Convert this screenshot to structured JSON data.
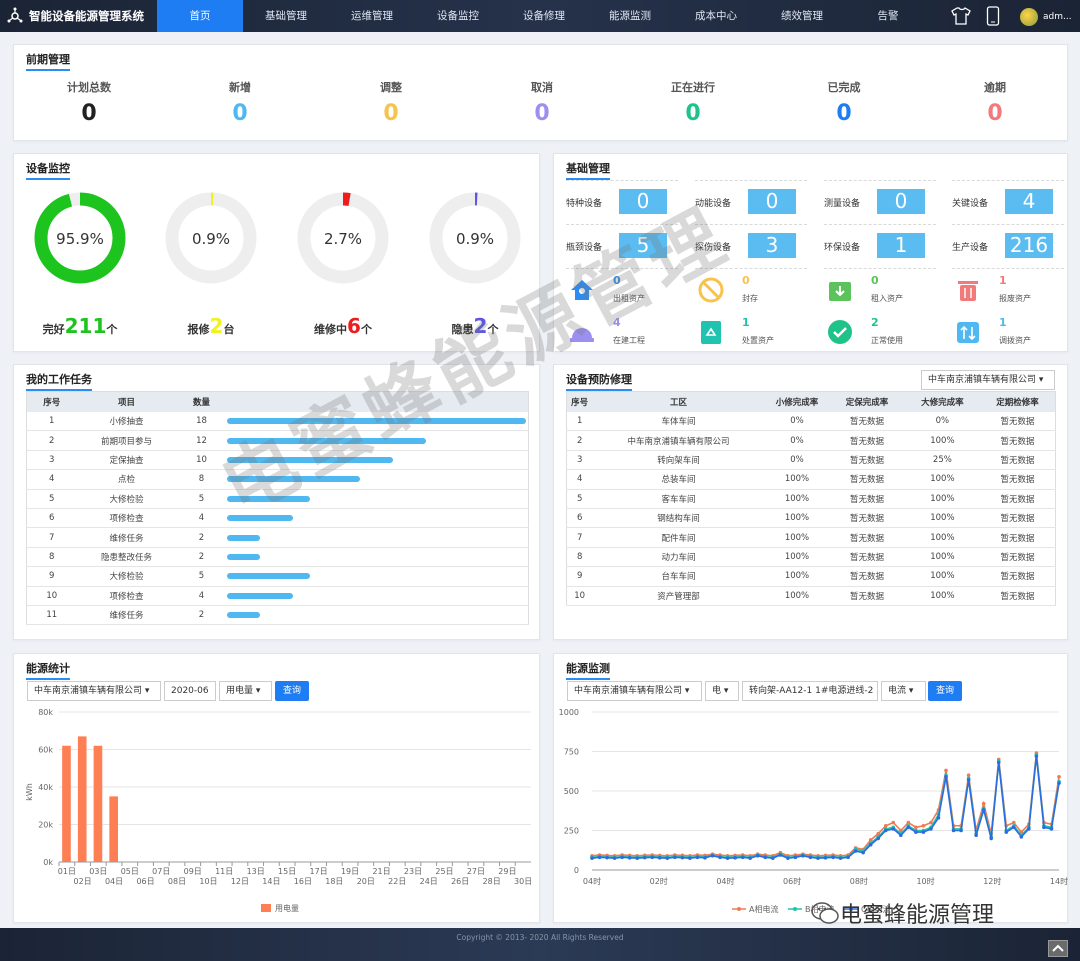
{
  "app": {
    "title": "智能设备能源管理系统",
    "user": "adm..."
  },
  "nav": [
    "首页",
    "基础管理",
    "运维管理",
    "设备监控",
    "设备修理",
    "能源监测",
    "成本中心",
    "绩效管理",
    "告警"
  ],
  "pre": {
    "title": "前期管理",
    "stats": [
      {
        "label": "计划总数",
        "value": "0",
        "color": "#222222"
      },
      {
        "label": "新增",
        "value": "0",
        "color": "#4fb8f0"
      },
      {
        "label": "调整",
        "value": "0",
        "color": "#f7c34d"
      },
      {
        "label": "取消",
        "value": "0",
        "color": "#9b8ff0"
      },
      {
        "label": "正在进行",
        "value": "0",
        "color": "#1fc38a"
      },
      {
        "label": "已完成",
        "value": "0",
        "color": "#1e7df2"
      },
      {
        "label": "逾期",
        "value": "0",
        "color": "#f27a7a"
      }
    ]
  },
  "monitor": {
    "title": "设备监控",
    "donuts": [
      {
        "pct": "95.9%",
        "frac": 0.959,
        "color": "#1ec41e",
        "label": "完好",
        "count": "211",
        "unit": "个",
        "ccolor": "#1ec41e"
      },
      {
        "pct": "0.9%",
        "frac": 0.009,
        "color": "#f2f21e",
        "label": "报修",
        "count": "2",
        "unit": "台",
        "ccolor": "#f2f21e"
      },
      {
        "pct": "2.7%",
        "frac": 0.027,
        "color": "#ee1c1c",
        "label": "维修中",
        "count": "6",
        "unit": "个",
        "ccolor": "#ee1c1c"
      },
      {
        "pct": "0.9%",
        "frac": 0.009,
        "color": "#5b55e8",
        "label": "隐患",
        "count": "2",
        "unit": "个",
        "ccolor": "#5b55e8"
      }
    ]
  },
  "basic": {
    "title": "基础管理",
    "grid": [
      {
        "label": "特种设备",
        "value": "0"
      },
      {
        "label": "动能设备",
        "value": "0"
      },
      {
        "label": "测量设备",
        "value": "0"
      },
      {
        "label": "关键设备",
        "value": "4"
      },
      {
        "label": "瓶颈设备",
        "value": "5"
      },
      {
        "label": "探伤设备",
        "value": "3"
      },
      {
        "label": "环保设备",
        "value": "1"
      },
      {
        "label": "生产设备",
        "value": "216"
      }
    ],
    "assets": [
      {
        "icon": "house-icon",
        "num": "0",
        "text": "出租资产",
        "color": "#2d8cf0"
      },
      {
        "icon": "ban-icon",
        "num": "0",
        "text": "封存",
        "color": "#f7c34d"
      },
      {
        "icon": "download-box-icon",
        "num": "0",
        "text": "租入资产",
        "color": "#5cc35c"
      },
      {
        "icon": "trash-icon",
        "num": "1",
        "text": "报废资产",
        "color": "#f27a7a"
      },
      {
        "icon": "helmet-icon",
        "num": "4",
        "text": "在建工程",
        "color": "#9b8ff0"
      },
      {
        "icon": "recycle-icon",
        "num": "1",
        "text": "处置资产",
        "color": "#1fc3b0"
      },
      {
        "icon": "check-circle-icon",
        "num": "2",
        "text": "正常使用",
        "color": "#1fc38a"
      },
      {
        "icon": "transfer-icon",
        "num": "1",
        "text": "调拨资产",
        "color": "#4fb8f0"
      }
    ]
  },
  "tasks": {
    "title": "我的工作任务",
    "headers": [
      "序号",
      "项目",
      "数量"
    ],
    "max": 18,
    "rows": [
      {
        "no": "1",
        "item": "小修抽查",
        "qty": "18",
        "v": 18
      },
      {
        "no": "2",
        "item": "前期项目参与",
        "qty": "12",
        "v": 12
      },
      {
        "no": "3",
        "item": "定保抽查",
        "qty": "10",
        "v": 10
      },
      {
        "no": "4",
        "item": "点检",
        "qty": "8",
        "v": 8
      },
      {
        "no": "5",
        "item": "大修检验",
        "qty": "5",
        "v": 5
      },
      {
        "no": "6",
        "item": "项修检查",
        "qty": "4",
        "v": 4
      },
      {
        "no": "7",
        "item": "维修任务",
        "qty": "2",
        "v": 2
      },
      {
        "no": "8",
        "item": "隐患整改任务",
        "qty": "2",
        "v": 2
      },
      {
        "no": "9",
        "item": "大修检验",
        "qty": "5",
        "v": 5
      },
      {
        "no": "10",
        "item": "项修检查",
        "qty": "4",
        "v": 4
      },
      {
        "no": "11",
        "item": "维修任务",
        "qty": "2",
        "v": 2
      }
    ]
  },
  "prevent": {
    "title": "设备预防修理",
    "company": "中车南京浦镇车辆有限公司",
    "headers": [
      "序号",
      "工区",
      "小修完成率",
      "定保完成率",
      "大修完成率",
      "定期检修率"
    ],
    "rows": [
      [
        "1",
        "车体车间",
        "0%",
        "暂无数据",
        "0%",
        "暂无数据"
      ],
      [
        "2",
        "中车南京浦镇车辆有限公司",
        "0%",
        "暂无数据",
        "100%",
        "暂无数据"
      ],
      [
        "3",
        "转向架车间",
        "0%",
        "暂无数据",
        "25%",
        "暂无数据"
      ],
      [
        "4",
        "总装车间",
        "100%",
        "暂无数据",
        "100%",
        "暂无数据"
      ],
      [
        "5",
        "客车车间",
        "100%",
        "暂无数据",
        "100%",
        "暂无数据"
      ],
      [
        "6",
        "钢结构车间",
        "100%",
        "暂无数据",
        "100%",
        "暂无数据"
      ],
      [
        "7",
        "配件车间",
        "100%",
        "暂无数据",
        "100%",
        "暂无数据"
      ],
      [
        "8",
        "动力车间",
        "100%",
        "暂无数据",
        "100%",
        "暂无数据"
      ],
      [
        "9",
        "台车车间",
        "100%",
        "暂无数据",
        "100%",
        "暂无数据"
      ],
      [
        "10",
        "资产管理部",
        "100%",
        "暂无数据",
        "100%",
        "暂无数据"
      ]
    ]
  },
  "energy": {
    "title": "能源统计",
    "company": "中车南京浦镇车辆有限公司",
    "month": "2020-06",
    "type": "用电量",
    "query": "查询"
  },
  "emon": {
    "title": "能源监测",
    "company": "中车南京浦镇车辆有限公司",
    "medium": "电",
    "line": "转向架-AA12-1 1#电源进线-2",
    "param": "电流",
    "query": "查询"
  },
  "footer": {
    "copyright": "Copyright © 2013- 2020 All Rights Reserved"
  },
  "watermark": {
    "text": "电蜜蜂能源管理",
    "brand": "电蜜蜂能源管理"
  },
  "chart_data": [
    {
      "type": "bar",
      "title": "",
      "ylabel": "kWh",
      "ylim": [
        0,
        80000
      ],
      "yticks": [
        "0k",
        "20k",
        "40k",
        "60k",
        "80k"
      ],
      "categories": [
        "01日",
        "02日",
        "03日",
        "04日",
        "05日",
        "06日",
        "07日",
        "08日",
        "09日",
        "10日",
        "11日",
        "12日",
        "13日",
        "14日",
        "15日",
        "16日",
        "17日",
        "18日",
        "19日",
        "20日",
        "21日",
        "22日",
        "23日",
        "24日",
        "25日",
        "26日",
        "27日",
        "28日",
        "29日",
        "30日"
      ],
      "series": [
        {
          "name": "用电量",
          "color": "#ff7f55",
          "values": [
            62000,
            67000,
            62000,
            35000,
            0,
            0,
            0,
            0,
            0,
            0,
            0,
            0,
            0,
            0,
            0,
            0,
            0,
            0,
            0,
            0,
            0,
            0,
            0,
            0,
            0,
            0,
            0,
            0,
            0,
            0
          ]
        }
      ]
    },
    {
      "type": "line",
      "title": "",
      "ylim": [
        0,
        1000
      ],
      "yticks": [
        "0",
        "250",
        "500",
        "750",
        "1000"
      ],
      "xticks": [
        "04时",
        "02时",
        "04时",
        "06时",
        "08时",
        "10时",
        "12时",
        "14时"
      ],
      "series": [
        {
          "name": "A相电流",
          "color": "#f07a52",
          "values": [
            90,
            95,
            92,
            90,
            95,
            92,
            90,
            93,
            95,
            92,
            90,
            95,
            93,
            90,
            95,
            92,
            100,
            95,
            90,
            92,
            95,
            90,
            100,
            95,
            90,
            110,
            90,
            95,
            100,
            95,
            90,
            92,
            95,
            90,
            95,
            140,
            130,
            190,
            230,
            280,
            300,
            250,
            300,
            270,
            280,
            300,
            380,
            630,
            280,
            280,
            600,
            250,
            420,
            230,
            700,
            280,
            300,
            240,
            290,
            740,
            300,
            290,
            590
          ]
        },
        {
          "name": "B相电流",
          "color": "#1fc3b0",
          "values": [
            80,
            85,
            82,
            80,
            85,
            82,
            80,
            83,
            85,
            82,
            80,
            85,
            83,
            80,
            85,
            82,
            95,
            85,
            80,
            82,
            85,
            80,
            95,
            85,
            80,
            100,
            80,
            85,
            95,
            85,
            80,
            82,
            85,
            80,
            85,
            130,
            120,
            170,
            210,
            260,
            270,
            230,
            280,
            250,
            250,
            270,
            350,
            600,
            260,
            260,
            580,
            230,
            390,
            210,
            690,
            250,
            280,
            220,
            270,
            730,
            280,
            270,
            560
          ]
        },
        {
          "name": "C相电流",
          "color": "#2d6cdf",
          "values": [
            75,
            80,
            78,
            75,
            80,
            77,
            75,
            78,
            80,
            77,
            75,
            80,
            78,
            75,
            80,
            77,
            90,
            80,
            75,
            77,
            80,
            75,
            90,
            80,
            75,
            95,
            75,
            80,
            90,
            80,
            75,
            77,
            80,
            75,
            80,
            120,
            110,
            160,
            200,
            250,
            260,
            220,
            270,
            240,
            240,
            260,
            330,
            590,
            250,
            250,
            570,
            220,
            380,
            200,
            680,
            240,
            270,
            210,
            260,
            720,
            270,
            260,
            550
          ]
        }
      ]
    }
  ]
}
